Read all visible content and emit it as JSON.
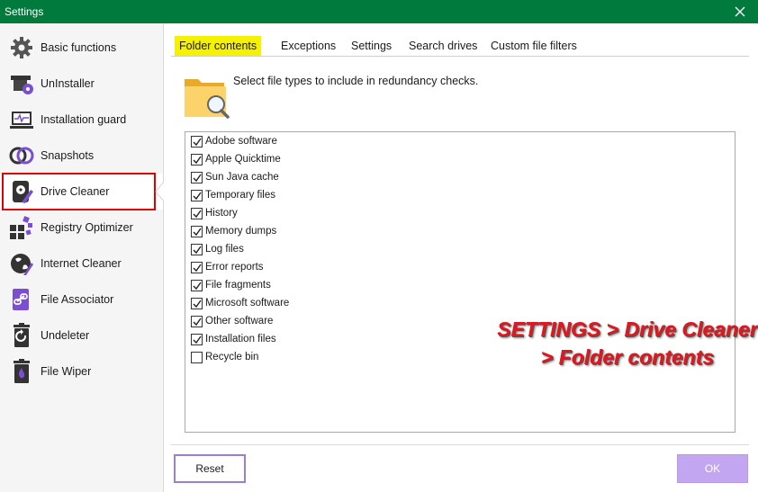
{
  "window": {
    "title": "Settings"
  },
  "sidebar": {
    "items": [
      {
        "label": "Basic functions",
        "icon": "gear-icon"
      },
      {
        "label": "UnInstaller",
        "icon": "uninstaller-icon"
      },
      {
        "label": "Installation guard",
        "icon": "installation-guard-icon"
      },
      {
        "label": "Snapshots",
        "icon": "snapshots-icon"
      },
      {
        "label": "Drive Cleaner",
        "icon": "drive-cleaner-icon"
      },
      {
        "label": "Registry Optimizer",
        "icon": "registry-optimizer-icon"
      },
      {
        "label": "Internet Cleaner",
        "icon": "internet-cleaner-icon"
      },
      {
        "label": "File Associator",
        "icon": "file-associator-icon"
      },
      {
        "label": "Undeleter",
        "icon": "undeleter-icon"
      },
      {
        "label": "File Wiper",
        "icon": "file-wiper-icon"
      }
    ],
    "active": "Drive Cleaner"
  },
  "tabs": [
    {
      "label": "Folder contents"
    },
    {
      "label": "Exceptions"
    },
    {
      "label": "Settings"
    },
    {
      "label": "Search drives"
    },
    {
      "label": "Custom file filters"
    }
  ],
  "active_tab": "Folder contents",
  "intro_text": "Select file types to include in redundancy checks.",
  "file_types": [
    {
      "label": "Adobe software",
      "checked": true
    },
    {
      "label": "Apple Quicktime",
      "checked": true
    },
    {
      "label": "Sun Java cache",
      "checked": true
    },
    {
      "label": "Temporary files",
      "checked": true
    },
    {
      "label": "History",
      "checked": true
    },
    {
      "label": "Memory dumps",
      "checked": true
    },
    {
      "label": "Log files",
      "checked": true
    },
    {
      "label": "Error reports",
      "checked": true
    },
    {
      "label": "File fragments",
      "checked": true
    },
    {
      "label": "Microsoft software",
      "checked": true
    },
    {
      "label": "Other software",
      "checked": true
    },
    {
      "label": "Installation files",
      "checked": true
    },
    {
      "label": "Recycle bin",
      "checked": false
    }
  ],
  "annotation": {
    "line1": "SETTINGS > Drive Cleaner",
    "line2": "> Folder contents"
  },
  "buttons": {
    "reset": "Reset",
    "ok": "OK"
  },
  "colors": {
    "titlebar": "#007a3d",
    "accent": "#7a4fd0",
    "tab_highlight": "#f6f100",
    "annotation": "#e8141b",
    "highlight_box": "#e00000"
  }
}
